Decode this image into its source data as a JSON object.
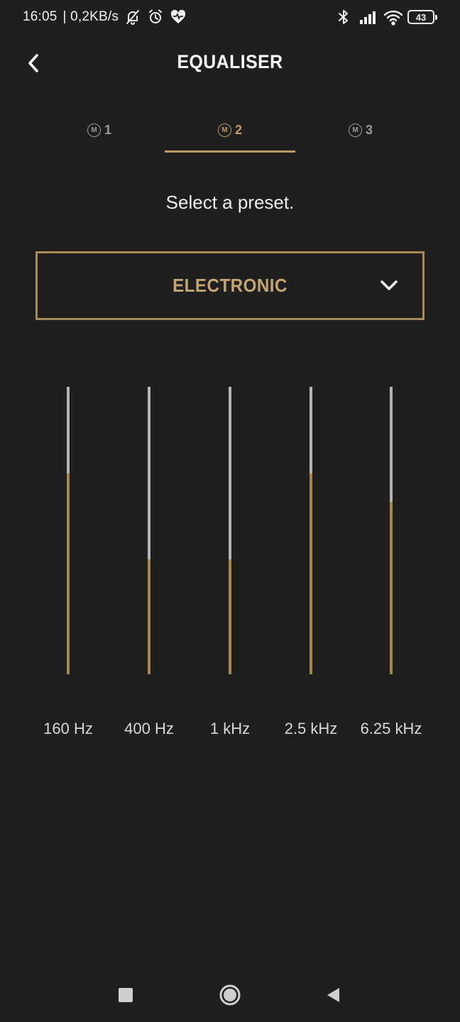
{
  "status_bar": {
    "time": "16:05",
    "network_speed": "| 0,2KB/s",
    "battery_level": "43",
    "icons": [
      "bell-off-icon",
      "alarm-icon",
      "heart-icon",
      "bluetooth-icon",
      "signal-icon",
      "wifi-icon",
      "battery-icon"
    ]
  },
  "header": {
    "title": "EQUALISER",
    "back_icon": "chevron-left-icon"
  },
  "tabs": [
    {
      "badge": "M",
      "label": "1",
      "active": false
    },
    {
      "badge": "M",
      "label": "2",
      "active": true
    },
    {
      "badge": "M",
      "label": "3",
      "active": false
    }
  ],
  "instruction": "Select a preset.",
  "preset": {
    "selected": "ELECTRONIC",
    "icon": "chevron-down-icon"
  },
  "equaliser": {
    "bands": [
      {
        "label": "160 Hz",
        "level": 0.7
      },
      {
        "label": "400 Hz",
        "level": 0.4
      },
      {
        "label": "1 kHz",
        "level": 0.4
      },
      {
        "label": "2.5 kHz",
        "level": 0.7
      },
      {
        "label": "6.25 kHz",
        "level": 0.6
      }
    ]
  },
  "colors": {
    "background": "#1f1f1f",
    "accent": "#b89a62",
    "track": "#b4b4b4",
    "inactive_tab": "#9a9a9a"
  },
  "navigation": {
    "icons": [
      "square-icon",
      "circle-home-icon",
      "back-triangle-icon"
    ]
  }
}
